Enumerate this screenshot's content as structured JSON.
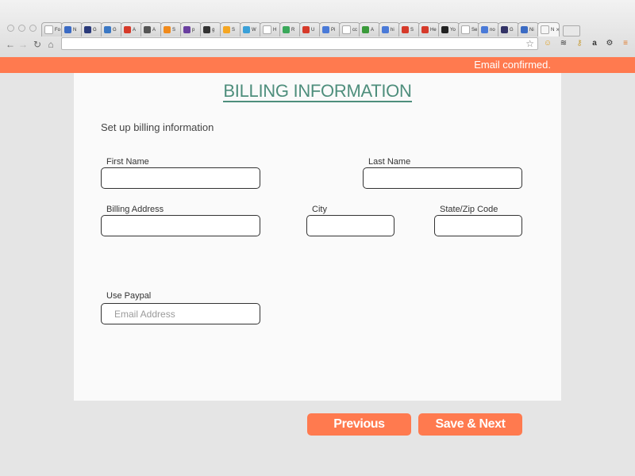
{
  "browser": {
    "tabs": [
      {
        "label": "Fo",
        "icon": "page-icon",
        "color": "#ffffff"
      },
      {
        "label": "N",
        "icon": "chevrons-icon",
        "color": "#3b6bc4"
      },
      {
        "label": "G",
        "icon": "flickr-f-icon",
        "color": "#2a3a7a"
      },
      {
        "label": "G",
        "icon": "gc-icon",
        "color": "#3b78c4"
      },
      {
        "label": "A",
        "icon": "a-icon",
        "color": "#d63a2a"
      },
      {
        "label": "A",
        "icon": "bike-icon",
        "color": "#555555"
      },
      {
        "label": "S",
        "icon": "e-icon",
        "color": "#f08a1c"
      },
      {
        "label": "p",
        "icon": "peace-icon",
        "color": "#6a3fa0"
      },
      {
        "label": "g",
        "icon": "hash-icon",
        "color": "#333333"
      },
      {
        "label": "S",
        "icon": "bolt-icon",
        "color": "#f5a623"
      },
      {
        "label": "W",
        "icon": "wave-icon",
        "color": "#3aa0d8"
      },
      {
        "label": "H",
        "icon": "page-icon",
        "color": "#ffffff"
      },
      {
        "label": "R",
        "icon": "drive-icon",
        "color": "#3aa85a"
      },
      {
        "label": "U",
        "icon": "red-box-icon",
        "color": "#d63a2a"
      },
      {
        "label": "Pi",
        "icon": "doc-icon",
        "color": "#4a7ad8"
      },
      {
        "label": "cc",
        "icon": "page-icon",
        "color": "#ffffff"
      },
      {
        "label": "A",
        "icon": "green-box-icon",
        "color": "#3a9a3a"
      },
      {
        "label": "hi",
        "icon": "google-g-icon",
        "color": "#4a7ad8"
      },
      {
        "label": "S",
        "icon": "dash-icon",
        "color": "#d63a2a"
      },
      {
        "label": "He",
        "icon": "bars-icon",
        "color": "#d63a2a"
      },
      {
        "label": "Yo",
        "icon": "car-icon",
        "color": "#222222"
      },
      {
        "label": "Se",
        "icon": "blank-icon",
        "color": "#ffffff"
      },
      {
        "label": "no",
        "icon": "google-g-icon",
        "color": "#4a7ad8"
      },
      {
        "label": "G",
        "icon": "mail-icon",
        "color": "#333366"
      },
      {
        "label": "Ni",
        "icon": "chevrons-icon",
        "color": "#3b6bc4"
      },
      {
        "label": "N",
        "icon": "close-icon",
        "color": "#f6f6f6",
        "active": true
      }
    ],
    "extensions": [
      "star-icon",
      "smiley-icon",
      "layers-icon",
      "key-icon",
      "amazon-icon",
      "gear-icon",
      "menu-icon"
    ],
    "address": ""
  },
  "banner": {
    "message": "Email confirmed.",
    "color": "#ff7a4f"
  },
  "form": {
    "title": "BILLING INFORMATION",
    "subtitle": "Set up billing information",
    "first_name": {
      "label": "First Name",
      "value": "",
      "placeholder": ""
    },
    "last_name": {
      "label": "Last Name",
      "value": "",
      "placeholder": ""
    },
    "billing_address": {
      "label": "Billing Address",
      "value": "",
      "placeholder": ""
    },
    "city": {
      "label": "City",
      "value": "",
      "placeholder": ""
    },
    "state_zip": {
      "label": "State/Zip Code",
      "value": "",
      "placeholder": ""
    },
    "paypal": {
      "label": "Use Paypal",
      "value": "",
      "placeholder": "Email Address"
    }
  },
  "actions": {
    "previous_label": "Previous",
    "next_label": "Save & Next"
  },
  "colors": {
    "accent": "#ff7a4f",
    "title": "#4e8e7c"
  }
}
